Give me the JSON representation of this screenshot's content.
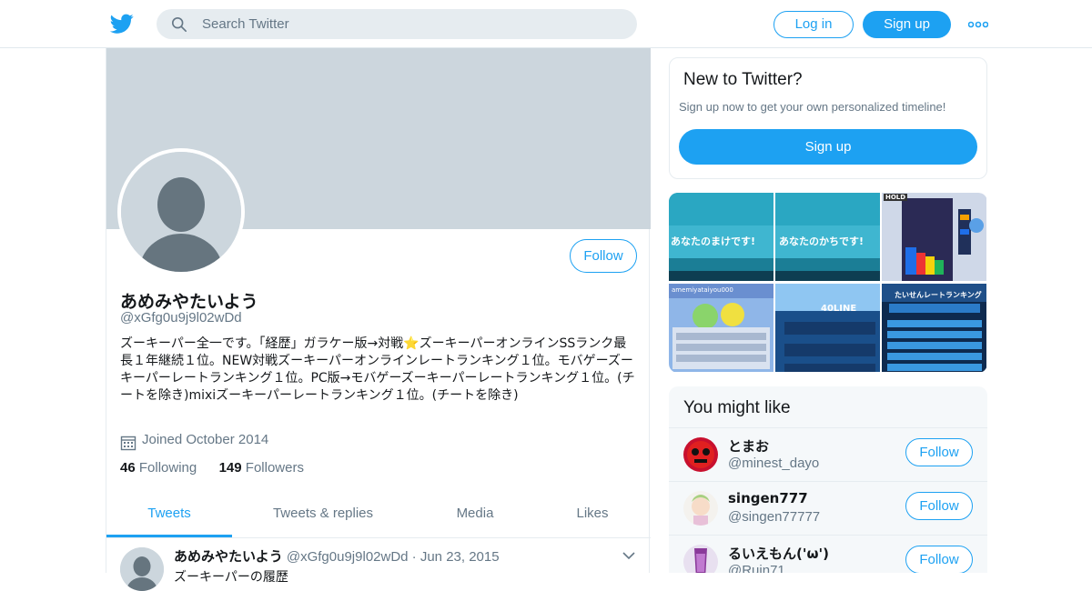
{
  "header": {
    "search_placeholder": "Search Twitter",
    "login_label": "Log in",
    "signup_label": "Sign up",
    "brand_color": "#1da1f2"
  },
  "profile": {
    "display_name": "あめみやたいよう",
    "handle": "@xGfg0u9j9l02wDd",
    "bio": "ズーキーパー全一です。「経歴」ガラケー版→対戦⭐ズーキーパーオンラインSSランク最長１年継続１位。NEW対戦ズーキーパーオンラインレートランキング１位。モバゲーズーキーパーレートランキング１位。PC版→モバゲーズーキーパーレートランキング１位。(チートを除き)mixiズーキーパーレートランキング１位。(チートを除き)",
    "joined": "Joined October 2014",
    "following_count": "46",
    "following_label": "Following",
    "followers_count": "149",
    "followers_label": "Followers",
    "follow_label": "Follow"
  },
  "tabs": [
    {
      "label": "Tweets",
      "active": true
    },
    {
      "label": "Tweets & replies",
      "active": false
    },
    {
      "label": "Media",
      "active": false
    },
    {
      "label": "Likes",
      "active": false
    }
  ],
  "tweet": {
    "name": "あめみやたいよう",
    "meta": "@xGfg0u9j9l02wDd · Jun 23, 2015",
    "text": "ズーキーパーの履歴"
  },
  "sidebar": {
    "new_title": "New to Twitter?",
    "new_sub": "Sign up now to get your own personalized timeline!",
    "new_signup": "Sign up",
    "might_like_title": "You might like",
    "suggestions": [
      {
        "name": "とまお",
        "handle": "@minest_dayo",
        "follow": "Follow"
      },
      {
        "name": "singen777",
        "handle": "@singen77777",
        "follow": "Follow"
      },
      {
        "name": "るいえもん('ω')",
        "handle": "@Ruin71",
        "follow": "Follow"
      }
    ],
    "media": [
      {
        "caption": "あなたのまけです!"
      },
      {
        "caption": "あなたのかちです!"
      },
      {
        "caption": "HOLD"
      },
      {
        "caption": "amemiyataiyou000"
      },
      {
        "caption": "40LINE"
      },
      {
        "caption": "たいせんレートランキング"
      }
    ]
  }
}
